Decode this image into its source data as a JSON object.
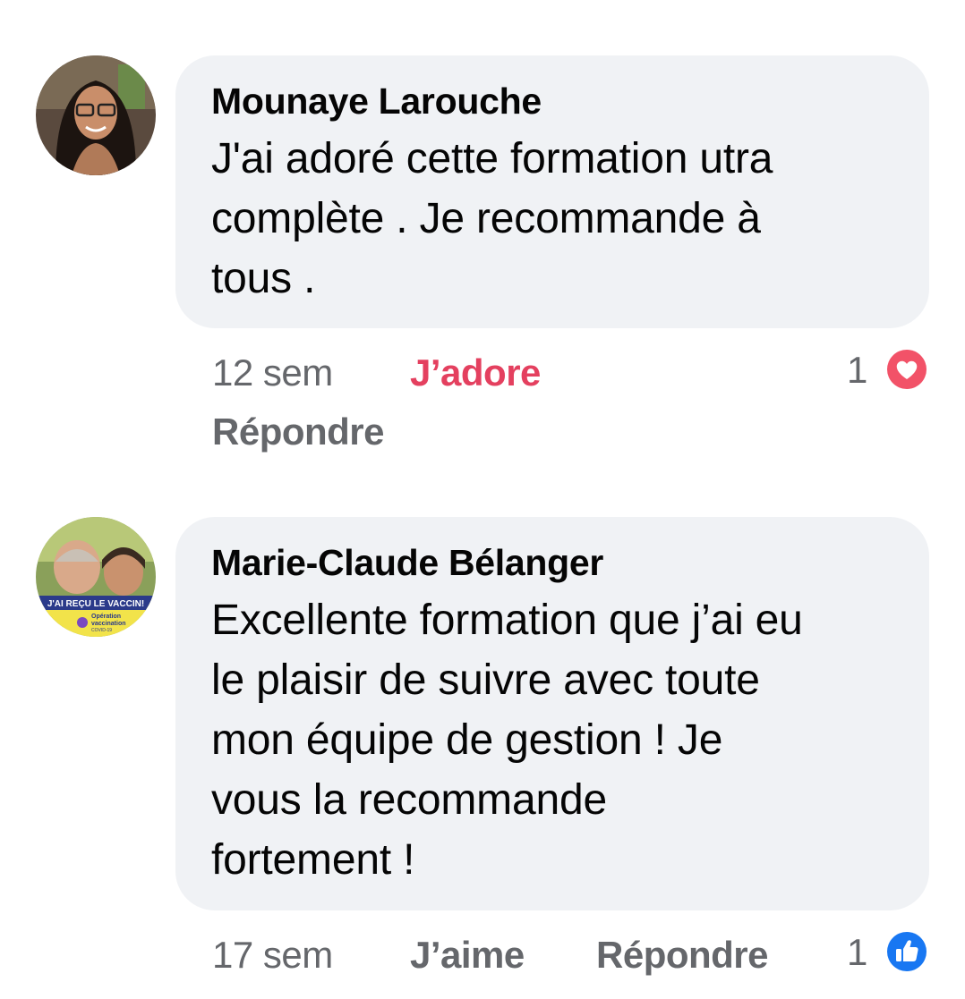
{
  "comments": [
    {
      "author": "Mounaye Larouche",
      "text": "J'ai adoré cette formation utra\ncomplète  . Je recommande à\ntous .",
      "time": "12 sem",
      "reaction_label": "J’adore",
      "reply_label": "Répondre",
      "reaction_count": "1",
      "reaction_icon": "heart-icon"
    },
    {
      "author": "Marie-Claude Bélanger",
      "text": "Excellente formation que j’ai eu\nle plaisir de suivre avec toute\nmon équipe de gestion ! Je\nvous la recommande\nfortement !",
      "time": "17 sem",
      "reaction_label": "J’aime",
      "reply_label": "Répondre",
      "reaction_count": "1",
      "reaction_icon": "like-thumb-icon",
      "avatar_frame": {
        "banner": "J'AI REÇU LE VACCIN!",
        "sub_1": "Opération",
        "sub_2": "vaccination",
        "sub_3": "COVID-19"
      }
    }
  ],
  "colors": {
    "bubble": "#f0f2f5",
    "meta": "#65676b",
    "love": "#e4405f",
    "like": "#1877f2"
  }
}
